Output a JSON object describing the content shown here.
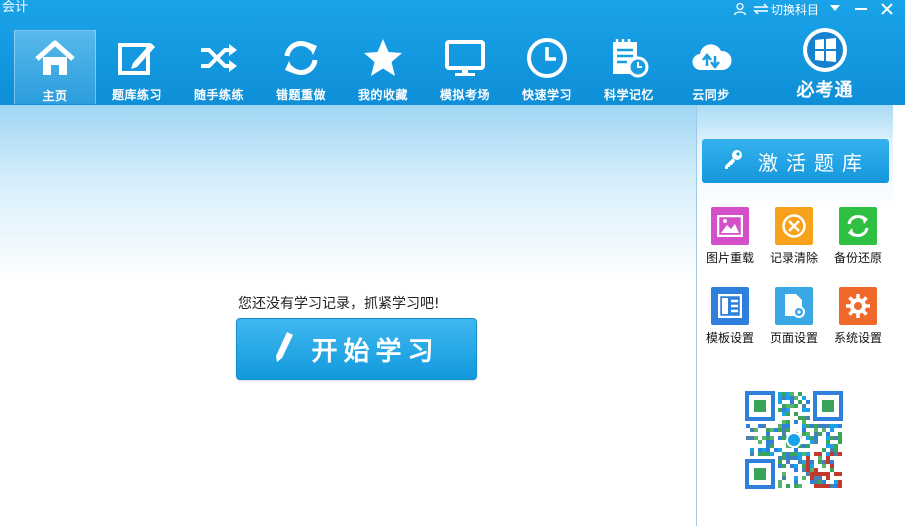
{
  "window": {
    "title": "会计",
    "switch_label": "切换科目",
    "icons": [
      "user-icon",
      "swap-icon",
      "dropdown-icon",
      "minimize-icon",
      "close-icon"
    ]
  },
  "nav": {
    "items": [
      {
        "label": "主页",
        "icon": "home-icon",
        "active": true
      },
      {
        "label": "题库练习",
        "icon": "edit-icon"
      },
      {
        "label": "随手练练",
        "icon": "shuffle-icon"
      },
      {
        "label": "错题重做",
        "icon": "refresh-icon"
      },
      {
        "label": "我的收藏",
        "icon": "star-icon"
      },
      {
        "label": "模拟考场",
        "icon": "monitor-icon"
      },
      {
        "label": "快速学习",
        "icon": "clock-icon"
      },
      {
        "label": "科学记忆",
        "icon": "notebook-clock-icon"
      },
      {
        "label": "云同步",
        "icon": "cloud-sync-icon"
      }
    ],
    "brand_label": "必考通"
  },
  "main": {
    "empty_message": "您还没有学习记录，抓紧学习吧!",
    "start_label": "开始学习"
  },
  "sidebar": {
    "activate_label": "激活题库",
    "tools": [
      {
        "label": "图片重载",
        "color": "#d44fc8",
        "icon": "image-icon"
      },
      {
        "label": "记录清除",
        "color": "#f7a21a",
        "icon": "clear-icon"
      },
      {
        "label": "备份还原",
        "color": "#2fbf43",
        "icon": "backup-icon"
      },
      {
        "label": "模板设置",
        "color": "#2f7fdc",
        "icon": "template-icon"
      },
      {
        "label": "页面设置",
        "color": "#3ba8e6",
        "icon": "page-settings-icon"
      },
      {
        "label": "系统设置",
        "color": "#ef6a2a",
        "icon": "system-settings-icon"
      }
    ]
  },
  "colors": {
    "header": "#0e8fd8",
    "accent": "#1a9ee0"
  }
}
